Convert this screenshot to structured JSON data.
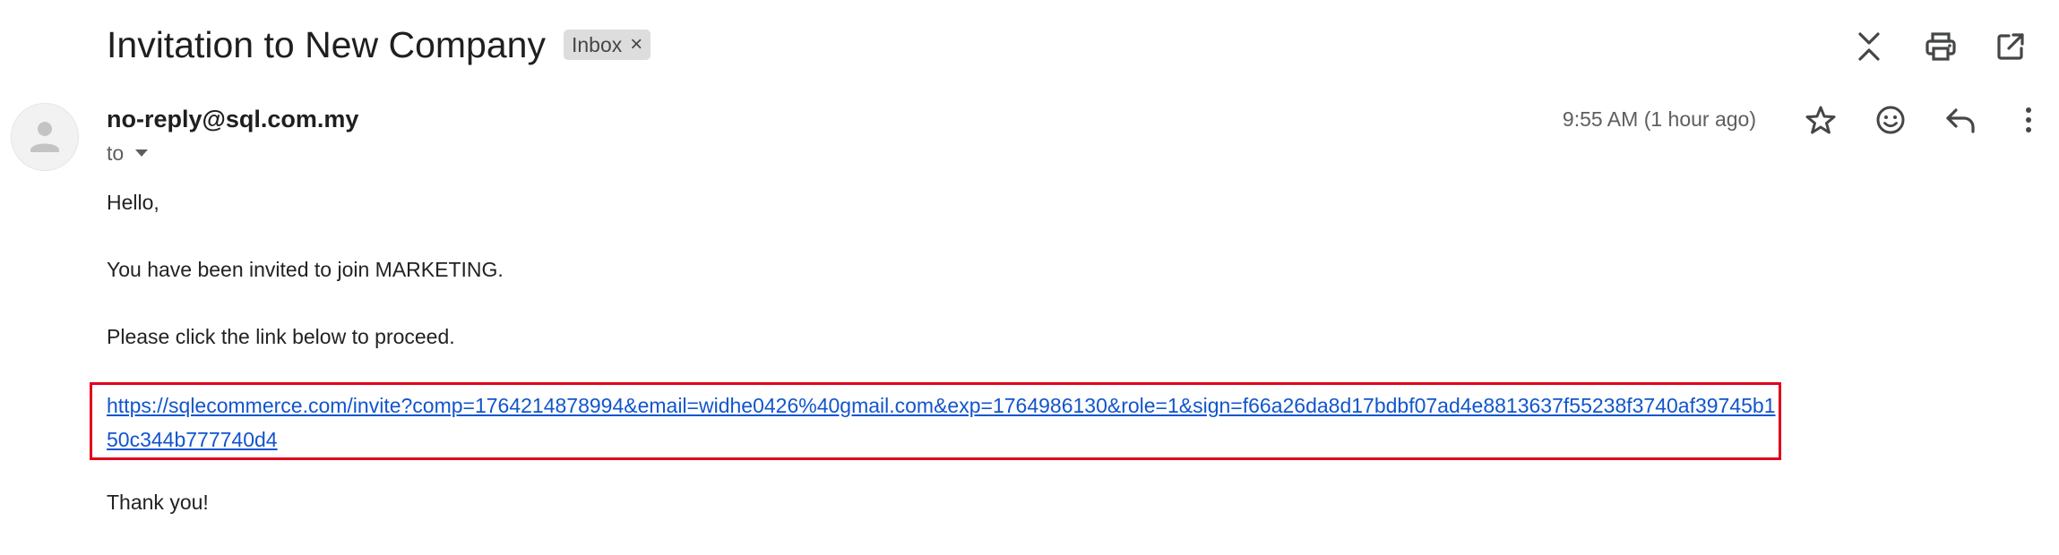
{
  "email": {
    "subject": "Invitation to New Company",
    "label_chip": "Inbox",
    "label_remove_glyph": "×",
    "sender": "no-reply@sql.com.my",
    "recipient_prefix": "to",
    "timestamp": "9:55 AM (1 hour ago)",
    "body": {
      "greeting": "Hello,",
      "line1": "You have been invited to join MARKETING.",
      "line2": "Please click the link below to proceed.",
      "link": "https://sqlecommerce.com/invite?comp=1764214878994&email=widhe0426%40gmail.com&exp=1764986130&role=1&sign=f66a26da8d17bdbf07ad4e8813637f55238f3740af39745b150c344b777740d4",
      "closing": "Thank you!"
    }
  },
  "icons": {
    "top": [
      "collapse-all-icon",
      "print-icon",
      "open-in-new-window-icon"
    ],
    "message": [
      "star-icon",
      "emoji-reaction-icon",
      "reply-icon",
      "more-vert-icon"
    ],
    "avatar": "default-avatar-icon",
    "to_dropdown": "caret-down-icon"
  },
  "colors": {
    "link": "#1155cc",
    "highlight_box": "#e0001b",
    "chip_bg": "#dddddd",
    "muted_text": "#5e5e5e"
  }
}
